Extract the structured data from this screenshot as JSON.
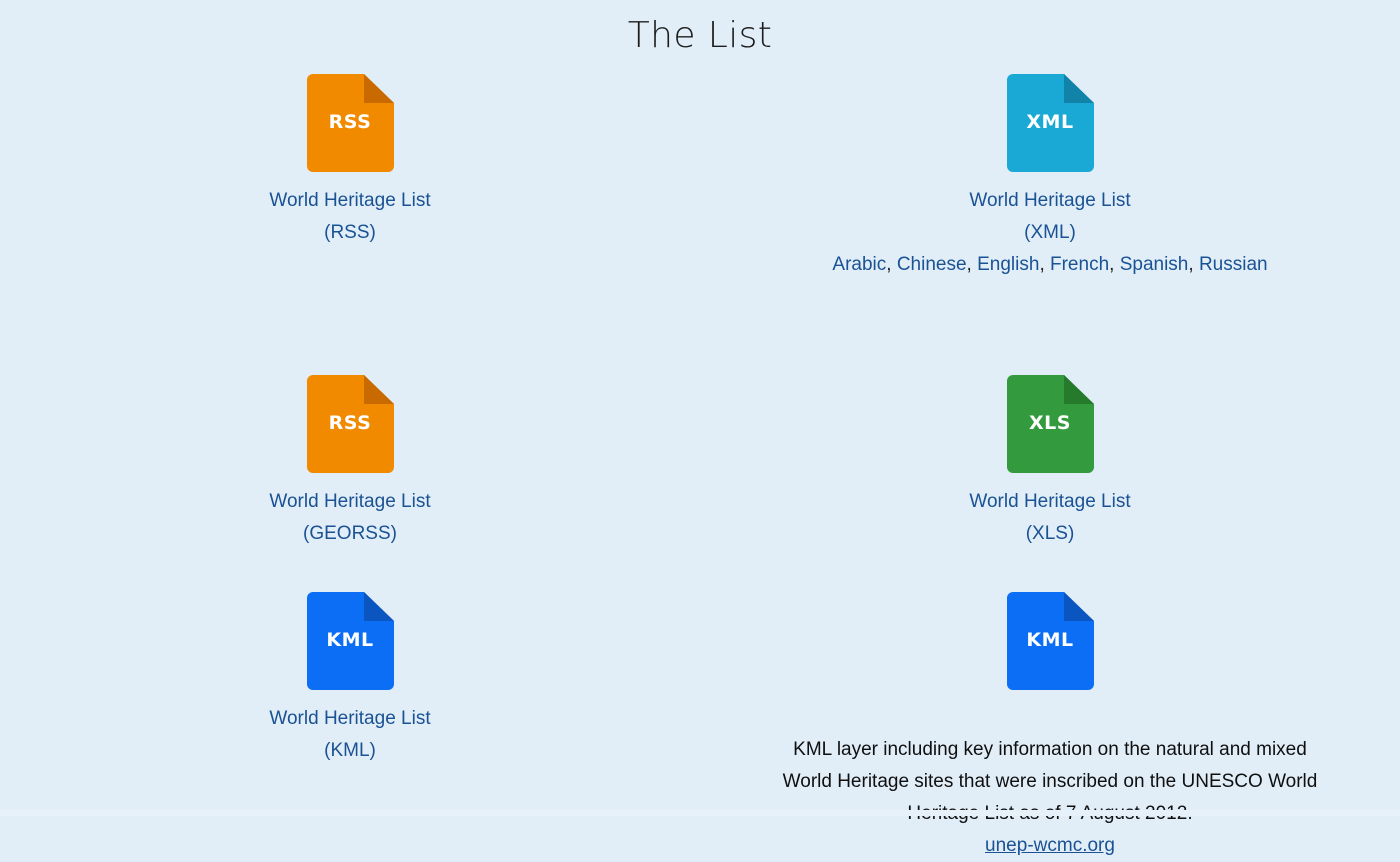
{
  "page": {
    "title": "The List",
    "background_color": "#e1eef8",
    "link_color": "#1a5294",
    "text_color": "#101010"
  },
  "items": [
    {
      "id": "rss",
      "icon": {
        "name": "rss-file-icon",
        "ext": "RSS",
        "color": "#f28a00",
        "fold_color": "#c96a00"
      },
      "caption_line1": "World Heritage List",
      "caption_line2": "(RSS)"
    },
    {
      "id": "xml",
      "icon": {
        "name": "xml-file-icon",
        "ext": "XML",
        "color": "#1aa8d4",
        "fold_color": "#1183a8"
      },
      "caption_line1": "World Heritage List",
      "caption_line2": "(XML)",
      "languages": [
        "Arabic",
        "Chinese",
        "English",
        "French",
        "Spanish",
        "Russian"
      ],
      "language_separator": ", "
    },
    {
      "id": "georss",
      "icon": {
        "name": "georss-file-icon",
        "ext": "RSS",
        "color": "#f28a00",
        "fold_color": "#c96a00"
      },
      "caption_line1": "World Heritage List",
      "caption_line2": "(GEORSS)"
    },
    {
      "id": "xls",
      "icon": {
        "name": "xls-file-icon",
        "ext": "XLS",
        "color": "#339b3d",
        "fold_color": "#257a2c"
      },
      "caption_line1": "World Heritage List",
      "caption_line2": "(XLS)"
    },
    {
      "id": "kml",
      "icon": {
        "name": "kml-file-icon",
        "ext": "KML",
        "color": "#0b6ef5",
        "fold_color": "#0b55c0"
      },
      "caption_line1": "World Heritage List",
      "caption_line2": "(KML)"
    },
    {
      "id": "kml-unep",
      "icon": {
        "name": "kml-unep-file-icon",
        "ext": "KML",
        "color": "#0b6ef5",
        "fold_color": "#0b55c0"
      },
      "description": "KML layer including key information on the natural and mixed World Heritage sites that were inscribed on the UNESCO World Heritage List as of 7 August 2012.",
      "source_link": "unep-wcmc.org"
    }
  ]
}
